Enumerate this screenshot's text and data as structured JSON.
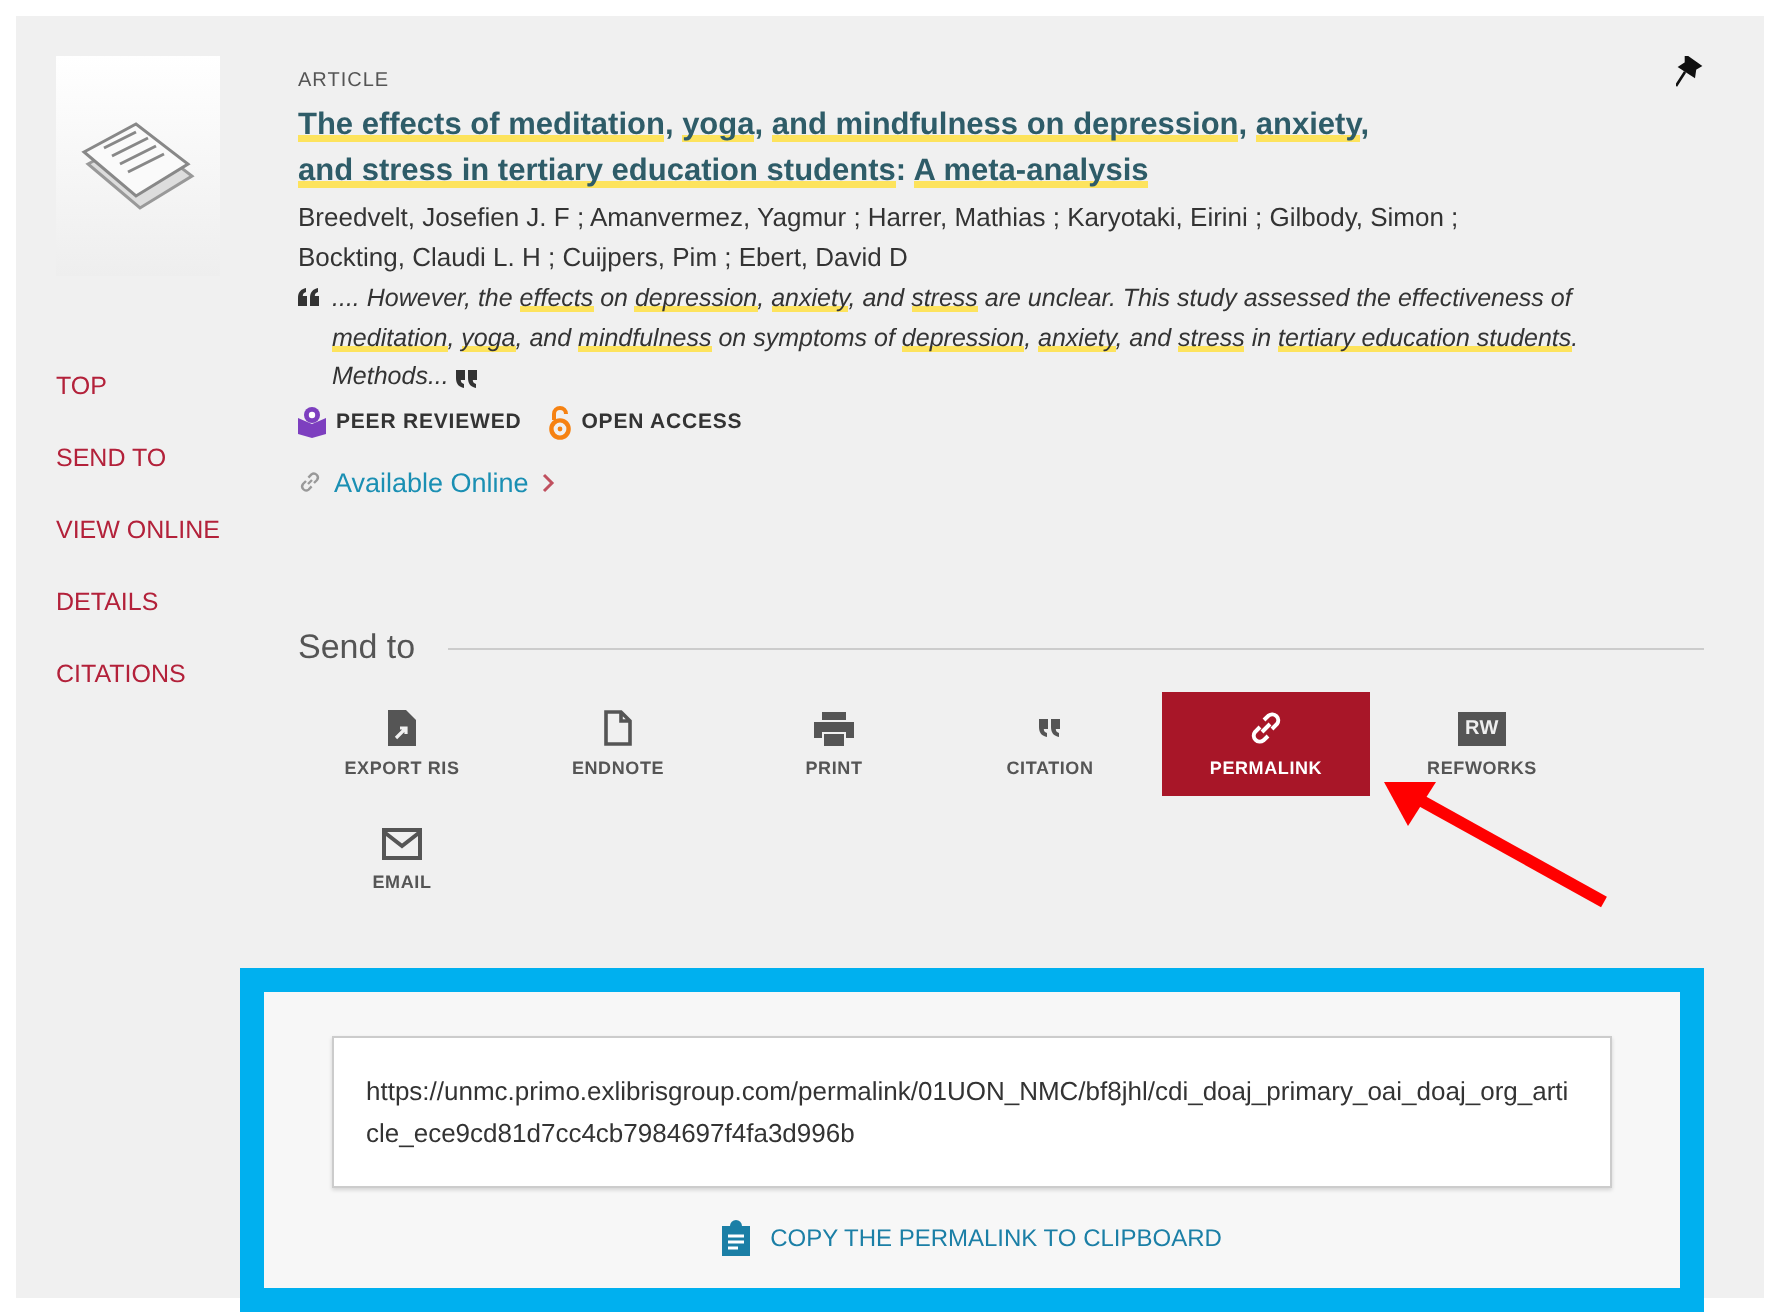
{
  "record": {
    "type": "ARTICLE",
    "title": [
      {
        "text": "The effects of meditation",
        "highlighted": true
      },
      {
        "text": ", ",
        "highlighted": false
      },
      {
        "text": "yoga",
        "highlighted": true
      },
      {
        "text": ", ",
        "highlighted": false
      },
      {
        "text": "and mindfulness on depression",
        "highlighted": true
      },
      {
        "text": ", ",
        "highlighted": false
      },
      {
        "text": "anxiety",
        "highlighted": true
      },
      {
        "text": ", ",
        "highlighted": false
      },
      {
        "text": "and stress in tertiary education students",
        "highlighted": true
      },
      {
        "text": ": ",
        "highlighted": false
      },
      {
        "text": "A meta-analysis",
        "highlighted": true
      }
    ],
    "authors": "Breedvelt, Josefien J. F ; Amanvermez, Yagmur ; Harrer, Mathias ; Karyotaki, Eirini ; Gilbody, Simon ; Bockting, Claudi L. H ; Cuijpers, Pim ; Ebert, David D",
    "snippet": [
      {
        "text": ".... However, the ",
        "highlighted": false
      },
      {
        "text": "effects",
        "highlighted": true
      },
      {
        "text": " on ",
        "highlighted": false
      },
      {
        "text": "depression",
        "highlighted": true
      },
      {
        "text": ", ",
        "highlighted": false
      },
      {
        "text": "anxiety",
        "highlighted": true
      },
      {
        "text": ", and ",
        "highlighted": false
      },
      {
        "text": "stress",
        "highlighted": true
      },
      {
        "text": " are unclear. This study assessed the effectiveness of ",
        "highlighted": false
      },
      {
        "text": "meditation",
        "highlighted": true
      },
      {
        "text": ", ",
        "highlighted": false
      },
      {
        "text": "yoga",
        "highlighted": true
      },
      {
        "text": ", and ",
        "highlighted": false
      },
      {
        "text": "mindfulness",
        "highlighted": true
      },
      {
        "text": " on symptoms of ",
        "highlighted": false
      },
      {
        "text": "depression",
        "highlighted": true
      },
      {
        "text": ", ",
        "highlighted": false
      },
      {
        "text": "anxiety",
        "highlighted": true
      },
      {
        "text": ", and ",
        "highlighted": false
      },
      {
        "text": "stress",
        "highlighted": true
      },
      {
        "text": " in ",
        "highlighted": false
      },
      {
        "text": "tertiary education students",
        "highlighted": true
      },
      {
        "text": ". Methods...",
        "highlighted": false
      }
    ],
    "badges": [
      {
        "kind": "peer",
        "label": "PEER REVIEWED"
      },
      {
        "kind": "open",
        "label": "OPEN ACCESS"
      }
    ],
    "availability": "Available Online"
  },
  "nav": [
    "TOP",
    "SEND TO",
    "VIEW ONLINE",
    "DETAILS",
    "CITATIONS"
  ],
  "send_to": {
    "heading": "Send to",
    "actions": [
      {
        "kind": "export",
        "label": "EXPORT RIS",
        "selected": false
      },
      {
        "kind": "endnote",
        "label": "ENDNOTE",
        "selected": false
      },
      {
        "kind": "print",
        "label": "PRINT",
        "selected": false
      },
      {
        "kind": "citation",
        "label": "CITATION",
        "selected": false
      },
      {
        "kind": "permalink",
        "label": "PERMALINK",
        "selected": true
      },
      {
        "kind": "refworks",
        "label": "REFWORKS",
        "icon_text": "RW",
        "selected": false
      },
      {
        "kind": "email",
        "label": "EMAIL",
        "selected": false
      }
    ]
  },
  "permalink": {
    "url": "https://unmc.primo.exlibrisgroup.com/permalink/01UON_NMC/bf8jhl/cdi_doaj_primary_oai_doaj_org_article_ece9cd81d7cc4cb7984697f4fa3d996b",
    "copy_label": "COPY THE PERMALINK TO CLIPBOARD"
  }
}
